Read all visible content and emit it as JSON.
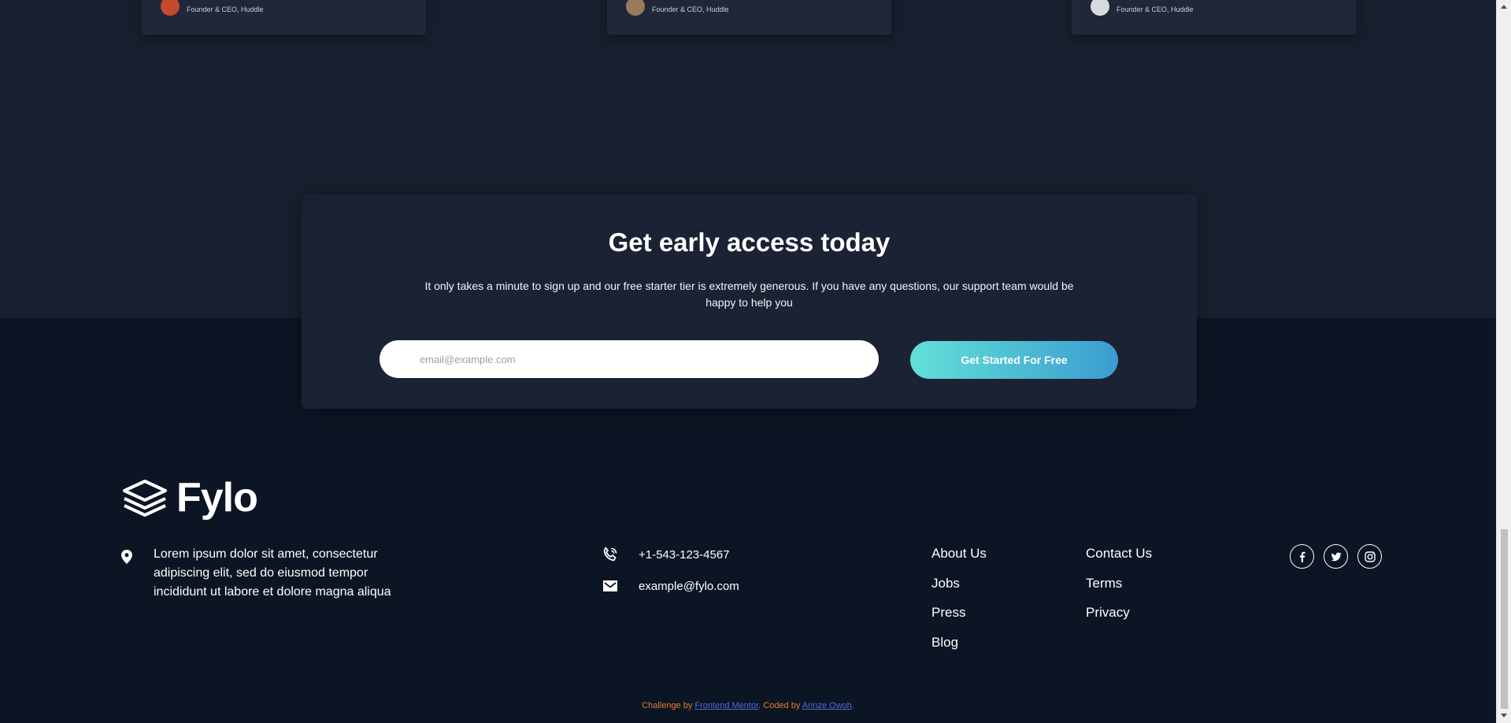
{
  "testimonials": [
    {
      "role": "Founder & CEO, Huddle"
    },
    {
      "role": "Founder & CEO, Huddle"
    },
    {
      "role": "Founder & CEO, Huddle"
    }
  ],
  "cta": {
    "title": "Get early access today",
    "description": "It only takes a minute to sign up and our free starter tier is extremely generous. If you have any questions, our support team would be happy to help you",
    "email_placeholder": "email@example.com",
    "button_label": "Get Started For Free"
  },
  "footer": {
    "logo_text": "Fylo",
    "address": "Lorem ipsum dolor sit amet, consectetur adipiscing elit, sed do eiusmod tempor incididunt ut labore et dolore magna aliqua",
    "phone": "+1-543-123-4567",
    "email": "example@fylo.com",
    "links_col1": [
      "About Us",
      "Jobs",
      "Press",
      "Blog"
    ],
    "links_col2": [
      "Contact Us",
      "Terms",
      "Privacy"
    ],
    "social": [
      "facebook-icon",
      "twitter-icon",
      "instagram-icon"
    ]
  },
  "attribution": {
    "prefix": "Challenge by",
    "mentor": "Frontend Mentor",
    "middle": ". Coded by",
    "author": "Arinze Owoh",
    "suffix": "."
  },
  "colors": {
    "top_band": "#181f2e",
    "footer_bg": "#0c1524",
    "cta_bg": "#1b2233",
    "button_gradient_start": "#62e0d7",
    "button_gradient_end": "#3b9cd0",
    "attribution_text": "#e9793a",
    "attribution_link": "#4d6bd6"
  }
}
